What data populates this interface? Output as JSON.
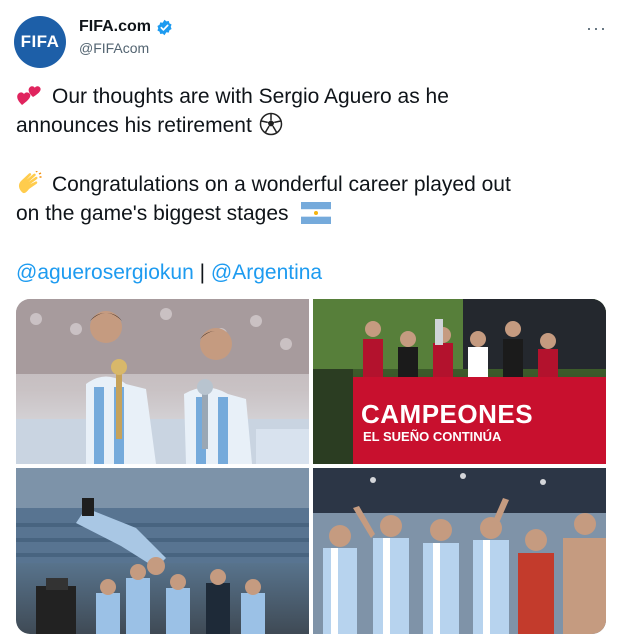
{
  "account": {
    "name": "FIFA.com",
    "handle": "@FIFAcom",
    "avatar_text": "FIFA",
    "verified_color": "#1d9bf0",
    "avatar_color": "#1d5fa8"
  },
  "menu": {
    "more_label": "···"
  },
  "tweet": {
    "line1": "Our thoughts are with Sergio Aguero as he",
    "line2": "announces his retirement",
    "line3": "Congratulations on a wonderful career played out",
    "line4": "on the game's biggest stages",
    "mention1": "@aguerosergiokun",
    "separator": " | ",
    "mention2": "@Argentina",
    "emoji": {
      "hearts": "two-hearts-icon",
      "ball": "soccer-ball-icon",
      "clap": "clapping-hands-icon",
      "flag": "argentina-flag-icon"
    }
  },
  "media": {
    "photo2_banner_title": "CAMPEONES",
    "photo2_banner_sub": "EL SUEÑO CONTINÚA"
  },
  "colors": {
    "link": "#1d9bf0",
    "text": "#0f1419",
    "muted": "#536471"
  }
}
